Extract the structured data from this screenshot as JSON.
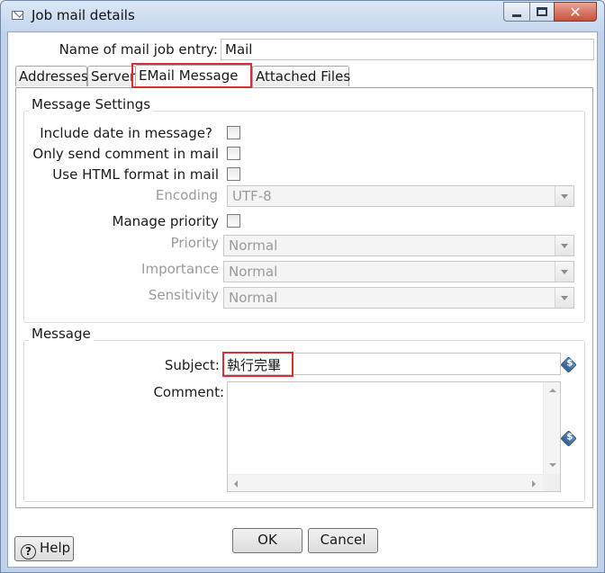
{
  "window": {
    "title": "Job mail details",
    "icon": "mail-icon",
    "controls": {
      "minimize": "minimize-icon",
      "maximize": "maximize-icon",
      "close_glyph": "✕"
    }
  },
  "entry": {
    "label": "Name of mail job entry:",
    "value": "Mail"
  },
  "tabs": [
    {
      "label": "Addresses"
    },
    {
      "label": "Server"
    },
    {
      "label": "EMail Message",
      "active": true
    },
    {
      "label": "Attached Files"
    }
  ],
  "message_settings": {
    "title": "Message Settings",
    "include_date_label": "Include date in message?",
    "include_date_checked": false,
    "only_comment_label": "Only send comment in mail",
    "only_comment_checked": false,
    "html_format_label": "Use HTML format in mail",
    "html_format_checked": false,
    "encoding_label": "Encoding",
    "encoding_value": "UTF-8",
    "manage_priority_label": "Manage priority",
    "manage_priority_checked": false,
    "priority_label": "Priority",
    "priority_value": "Normal",
    "importance_label": "Importance",
    "importance_value": "Normal",
    "sensitivity_label": "Sensitivity",
    "sensitivity_value": "Normal"
  },
  "message": {
    "title": "Message",
    "subject_label": "Subject:",
    "subject_value": "執行完畢",
    "comment_label": "Comment:",
    "comment_value": "",
    "variable_icon_glyph": "$"
  },
  "buttons": {
    "help_label": "Help",
    "help_glyph": "?",
    "ok_label": "OK",
    "cancel_label": "Cancel"
  },
  "colors": {
    "highlight": "#d8302f",
    "window_frame": "#bfd2ea",
    "disabled_text": "#9a9a9a"
  }
}
